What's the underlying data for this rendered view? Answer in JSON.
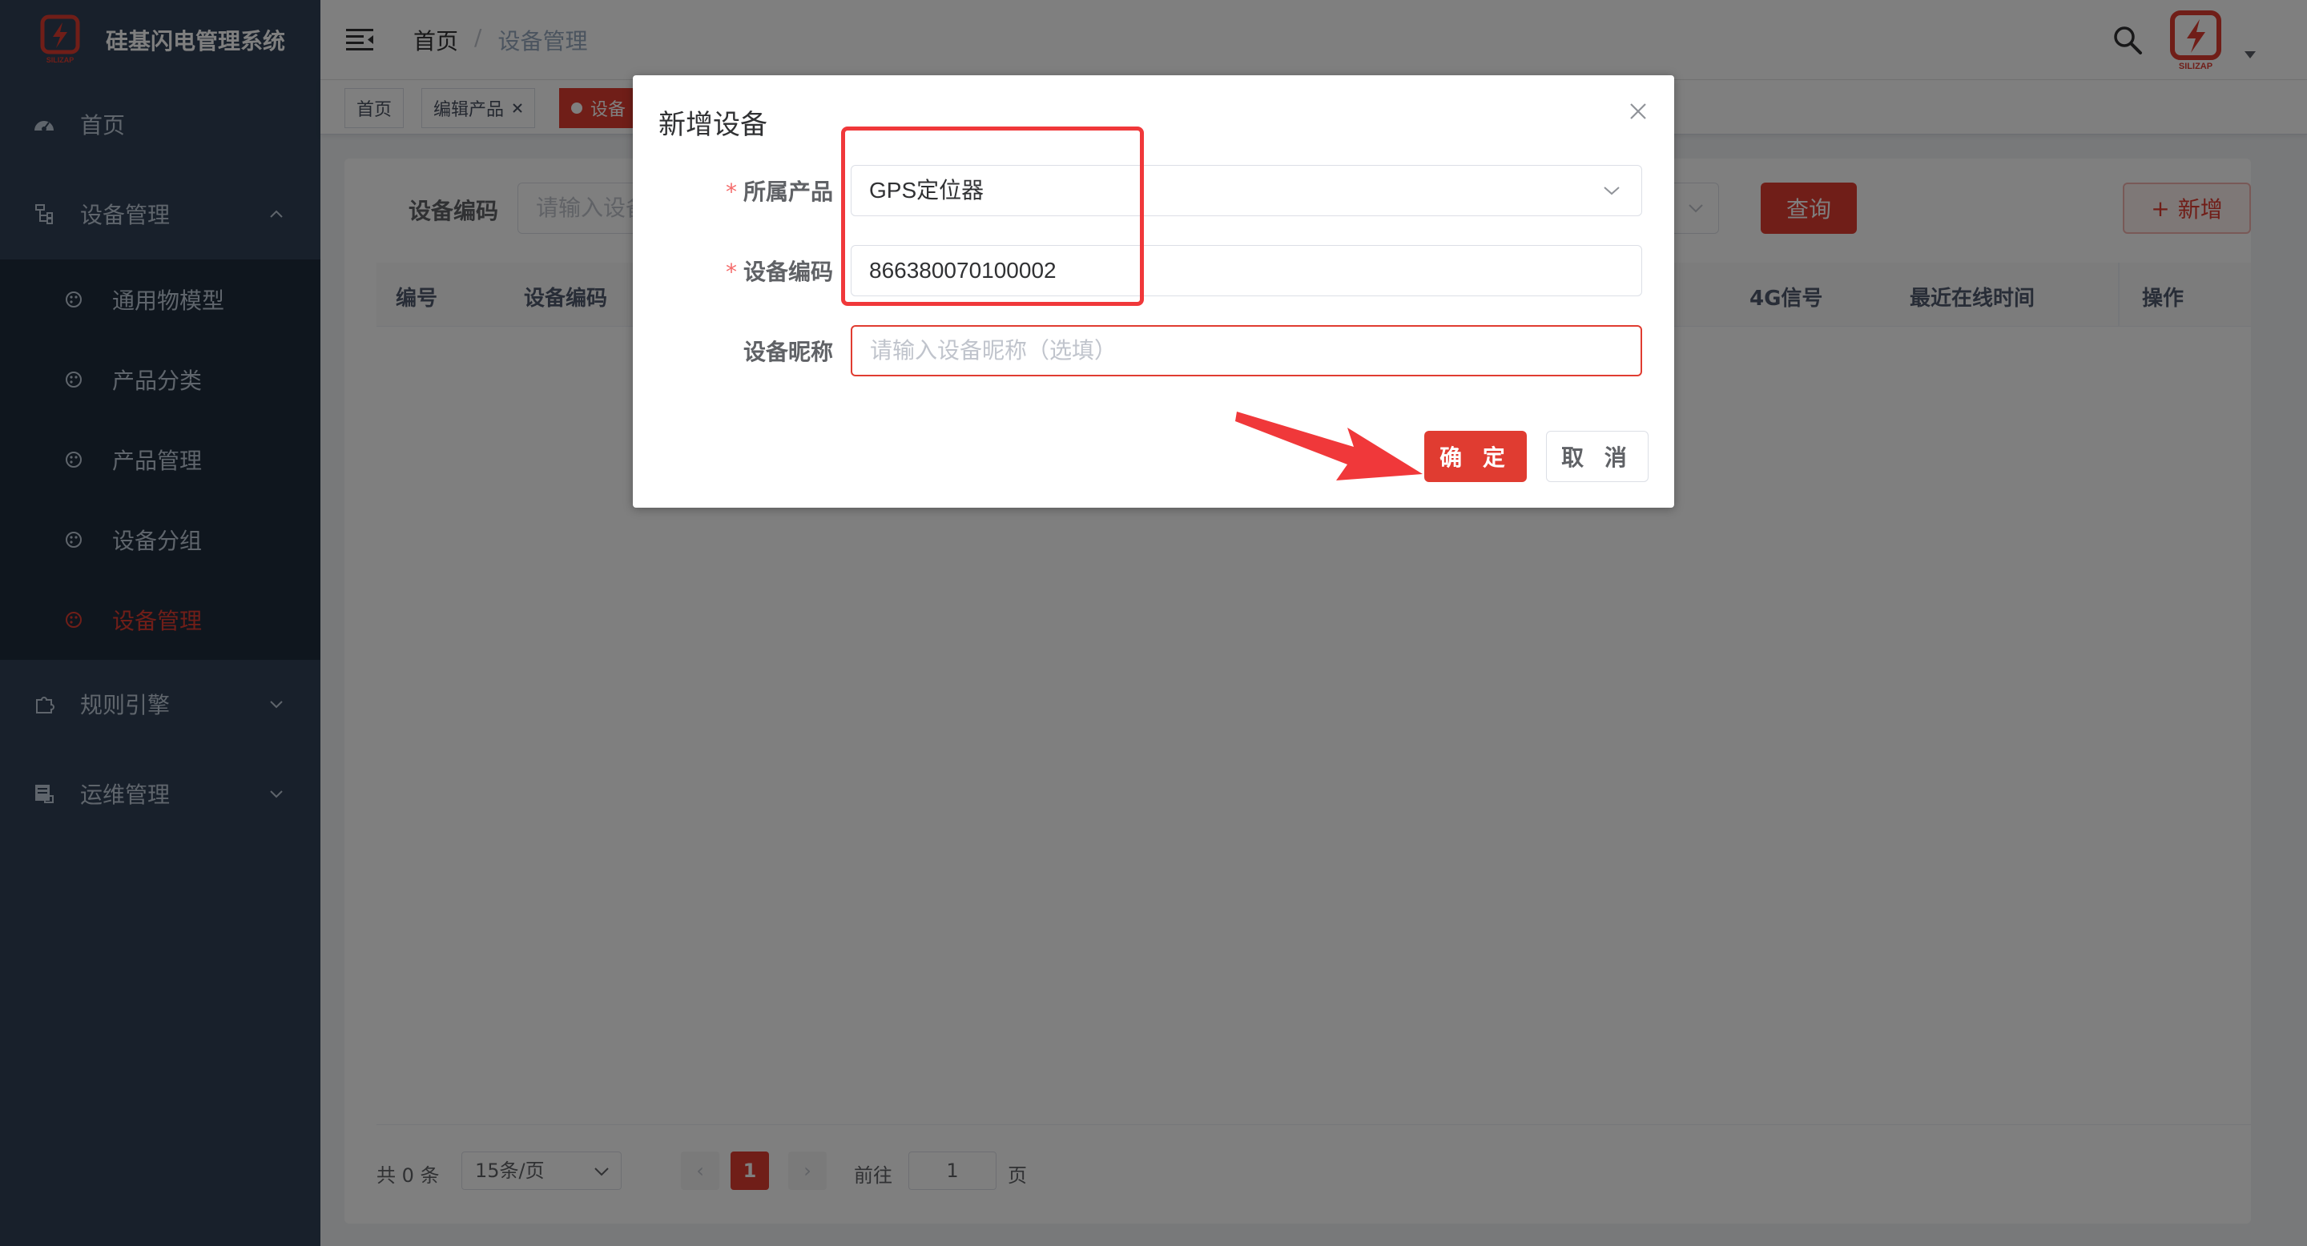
{
  "app": {
    "title": "硅基闪电管理系统",
    "logo_text": "SILIZAP",
    "accent": "#e03c31"
  },
  "sidebar": {
    "items": [
      {
        "label": "首页",
        "icon": "dashboard-icon"
      },
      {
        "label": "设备管理",
        "icon": "tree-icon",
        "expanded": true
      },
      {
        "label": "规则引擎",
        "icon": "puzzle-icon"
      },
      {
        "label": "运维管理",
        "icon": "monitor-icon"
      }
    ],
    "sub_items": [
      {
        "label": "通用物模型",
        "icon": "palette-icon"
      },
      {
        "label": "产品分类",
        "icon": "palette-icon"
      },
      {
        "label": "产品管理",
        "icon": "palette-icon"
      },
      {
        "label": "设备分组",
        "icon": "palette-icon"
      },
      {
        "label": "设备管理",
        "icon": "palette-icon",
        "active": true
      }
    ]
  },
  "header": {
    "breadcrumb": [
      "首页",
      "设备管理"
    ],
    "separator": "/"
  },
  "tags": [
    {
      "label": "首页"
    },
    {
      "label": "编辑产品",
      "closable": true
    },
    {
      "label": "设备",
      "active": true
    }
  ],
  "filter": {
    "label": "设备编码",
    "placeholder": "请输入设备",
    "query_button": "查询",
    "add_button": "新增",
    "add_icon": "+"
  },
  "table": {
    "columns": [
      "编号",
      "设备编码",
      "4G信号",
      "最近在线时间",
      "操作"
    ],
    "rows": []
  },
  "pagination": {
    "total": "共 0 条",
    "page_size": "15条/页",
    "current_page": "1",
    "goto_label": "前往",
    "goto_value": "1",
    "page_unit": "页",
    "prev_icon": "‹",
    "next_icon": "›"
  },
  "dialog": {
    "title": "新增设备",
    "fields": {
      "product": {
        "label": "所属产品",
        "required": true,
        "value": "GPS定位器"
      },
      "code": {
        "label": "设备编码",
        "required": true,
        "value": "866380070100002"
      },
      "nickname": {
        "label": "设备昵称",
        "required": false,
        "placeholder": "请输入设备昵称（选填）"
      }
    },
    "required_mark": "*",
    "confirm_label": "确 定",
    "cancel_label": "取 消"
  }
}
